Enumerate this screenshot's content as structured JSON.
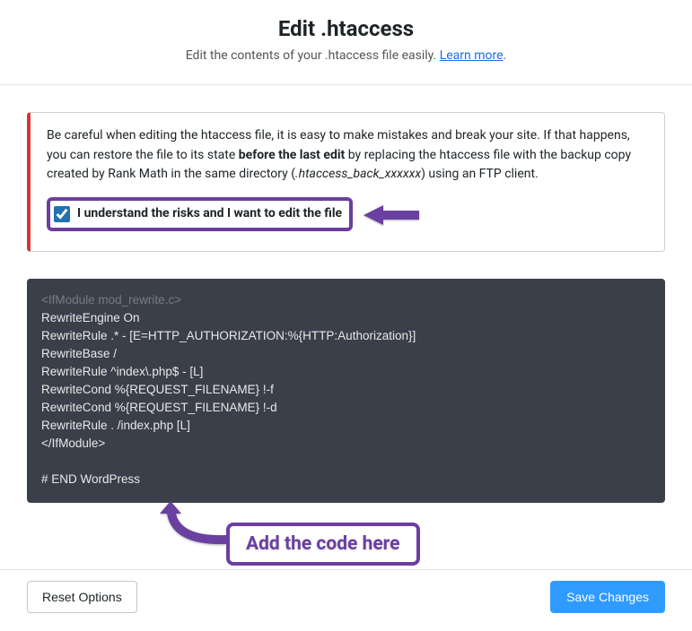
{
  "header": {
    "title": "Edit .htaccess",
    "subtitle_before": "Edit the contents of your .htaccess file easily. ",
    "learn_more": "Learn more",
    "subtitle_after": "."
  },
  "warning": {
    "text_before_bold": "Be careful when editing the htaccess file, it is easy to make mistakes and break your site. If that happens, you can restore the file to its state ",
    "bold_text": "before the last edit",
    "text_after_bold_before_italic": " by replacing the htaccess file with the backup copy created by Rank Math in the same directory (",
    "italic_text": ".htaccess_back_xxxxxx",
    "text_after_italic": ") using an FTP client.",
    "checkbox_label": "I understand the risks and I want to edit the file"
  },
  "code": {
    "line_faded": "<IfModule mod_rewrite.c>",
    "body": "RewriteEngine On\nRewriteRule .* - [E=HTTP_AUTHORIZATION:%{HTTP:Authorization}]\nRewriteBase /\nRewriteRule ^index\\.php$ - [L]\nRewriteCond %{REQUEST_FILENAME} !-f\nRewriteCond %{REQUEST_FILENAME} !-d\nRewriteRule . /index.php [L]\n</IfModule>\n\n# END WordPress"
  },
  "annotation": {
    "label": "Add the code here"
  },
  "footer": {
    "reset": "Reset Options",
    "save": "Save Changes"
  }
}
